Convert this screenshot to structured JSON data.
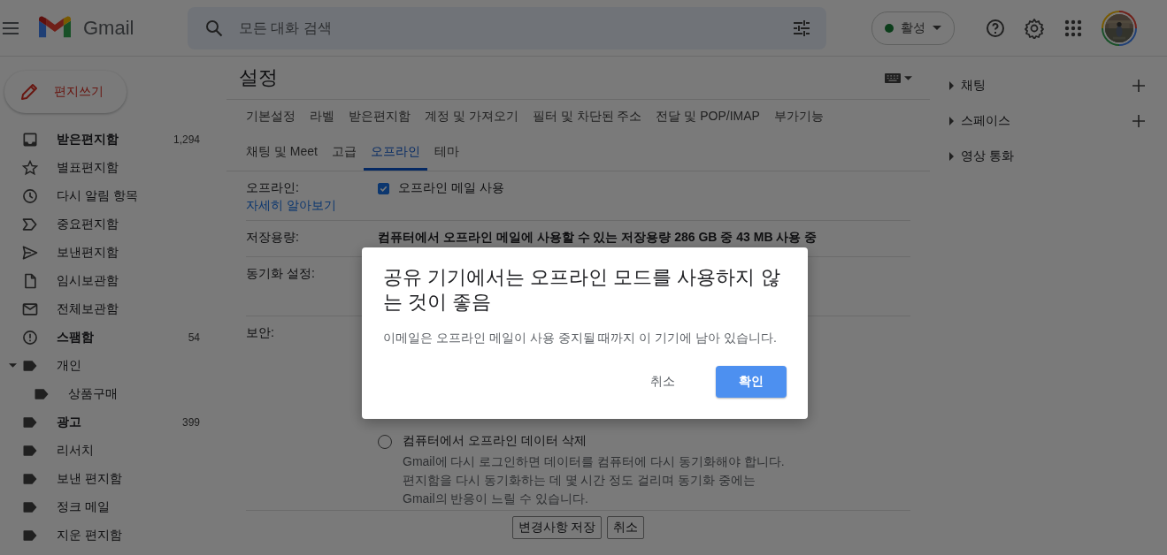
{
  "header": {
    "app_name": "Gmail",
    "search": {
      "placeholder": "모든 대화 검색"
    },
    "status": {
      "label": "활성"
    }
  },
  "compose": {
    "label": "편지쓰기"
  },
  "sidebar": {
    "items": [
      {
        "kind": "inbox",
        "label": "받은편지함",
        "count": "1,294",
        "unread": true
      },
      {
        "kind": "star",
        "label": "별표편지함",
        "unread": false
      },
      {
        "kind": "clock",
        "label": "다시 알림 항목",
        "unread": false
      },
      {
        "kind": "important",
        "label": "중요편지함",
        "unread": false
      },
      {
        "kind": "send",
        "label": "보낸편지함",
        "unread": false
      },
      {
        "kind": "file",
        "label": "임시보관함",
        "unread": false
      },
      {
        "kind": "mail",
        "label": "전체보관함",
        "unread": false
      },
      {
        "kind": "spam",
        "label": "스팸함",
        "count": "54",
        "unread": true
      },
      {
        "kind": "label",
        "label": "개인",
        "unread": false,
        "expanded": true,
        "children": [
          {
            "kind": "label",
            "label": "상품구매",
            "unread": false
          }
        ]
      },
      {
        "kind": "label",
        "label": "광고",
        "count": "399",
        "unread": true
      },
      {
        "kind": "label",
        "label": "리서치",
        "unread": false
      },
      {
        "kind": "label",
        "label": "보낸 편지함",
        "unread": false
      },
      {
        "kind": "label",
        "label": "정크 메일",
        "unread": false
      },
      {
        "kind": "label",
        "label": "지운 편지함",
        "unread": false
      }
    ]
  },
  "settings": {
    "title": "설정",
    "tab_rows": [
      [
        {
          "label": "기본설정",
          "selected": false
        },
        {
          "label": "라벨",
          "selected": false
        },
        {
          "label": "받은편지함",
          "selected": false
        },
        {
          "label": "계정 및 가져오기",
          "selected": false
        },
        {
          "label": "필터 및 차단된 주소",
          "selected": false
        },
        {
          "label": "전달 및 POP/IMAP",
          "selected": false
        },
        {
          "label": "부가기능",
          "selected": false
        }
      ],
      [
        {
          "label": "채팅 및 Meet",
          "selected": false
        },
        {
          "label": "고급",
          "selected": false
        },
        {
          "label": "오프라인",
          "selected": true
        },
        {
          "label": "테마",
          "selected": false
        }
      ]
    ],
    "rows": [
      {
        "kind": "checkbox",
        "label": "오프라인:",
        "link": "자세히 알아보기",
        "option": {
          "label": "오프라인 메일 사용",
          "checked": true
        }
      },
      {
        "kind": "text",
        "label": "저장용량:",
        "text": "컴퓨터에서 오프라인 메일에 사용할 수 있는 저장용량 286 GB 중 43 MB 사용 중"
      },
      {
        "kind": "empty",
        "label": "동기화 설정:"
      },
      {
        "kind": "radios",
        "label": "보안:",
        "options": [
          {
            "label": "컴퓨터에서 오프라인 데이터 삭제",
            "description": "Gmail에 다시 로그인하면 데이터를 컴퓨터에 다시 동기화해야 합니다. 편지함을 다시 동기화하는 데 몇 시간 정도 걸리며 동기화 중에는 Gmail의 반응이 느릴 수 있습니다.",
            "selected": false
          }
        ]
      }
    ],
    "buttons": [
      "변경사항 저장",
      "취소"
    ]
  },
  "side_panel": {
    "sections": [
      {
        "label": "채팅",
        "addable": true
      },
      {
        "label": "스페이스",
        "addable": true
      },
      {
        "label": "영상 통화",
        "addable": false
      }
    ]
  },
  "dialog": {
    "title": "공유 기기에서는 오프라인 모드를 사용하지 않는 것이 좋음",
    "message": "이메일은 오프라인 메일이 사용 중지될 때까지 이 기기에 남아 있습니다.",
    "buttons": [
      {
        "label": "취소",
        "primary": false
      },
      {
        "label": "확인",
        "primary": true
      }
    ]
  }
}
